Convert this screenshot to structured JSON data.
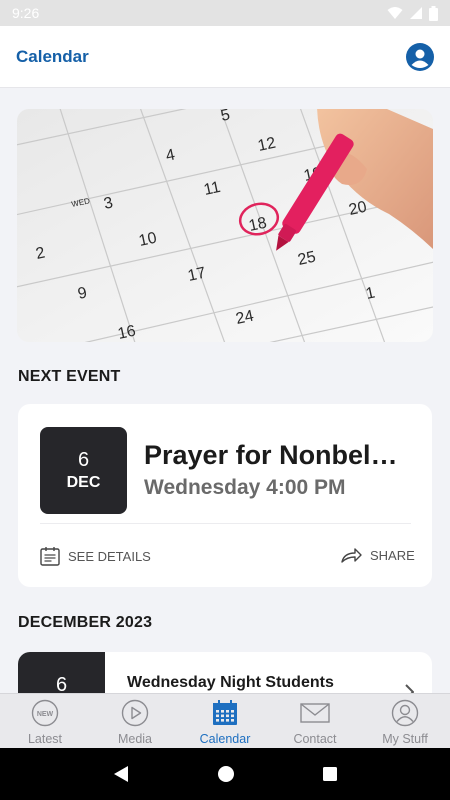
{
  "status_bar": {
    "time": "9:26",
    "icons": [
      "wifi-icon",
      "signal-icon",
      "battery-icon"
    ]
  },
  "header": {
    "title": "Calendar",
    "profile_icon": "profile-icon"
  },
  "hero": {
    "description_icon": "calendar-photo",
    "dates": [
      "5",
      "12",
      "4",
      "WED",
      "3",
      "11",
      "18",
      "19",
      "20",
      "10",
      "2",
      "17",
      "25",
      "9",
      "1",
      "24",
      "16"
    ]
  },
  "next_event": {
    "section_title": "NEXT EVENT",
    "day": "6",
    "month": "DEC",
    "title": "Prayer for Nonbel…",
    "time": "Wednesday 4:00 PM",
    "details_label": "SEE DETAILS",
    "share_label": "SHARE"
  },
  "month_section": {
    "title": "DECEMBER 2023",
    "items": [
      {
        "day": "6",
        "title": "Wednesday Night Students"
      }
    ]
  },
  "tabs": [
    {
      "label": "Latest",
      "icon": "new-badge-icon",
      "active": false
    },
    {
      "label": "Media",
      "icon": "play-icon",
      "active": false
    },
    {
      "label": "Calendar",
      "icon": "calendar-icon",
      "active": true
    },
    {
      "label": "Contact",
      "icon": "envelope-icon",
      "active": false
    },
    {
      "label": "My Stuff",
      "icon": "user-icon",
      "active": false
    }
  ],
  "colors": {
    "accent": "#1560a8",
    "active_tab": "#1e6fc0",
    "badge_bg": "#26262a",
    "background": "#f2f3f7"
  }
}
